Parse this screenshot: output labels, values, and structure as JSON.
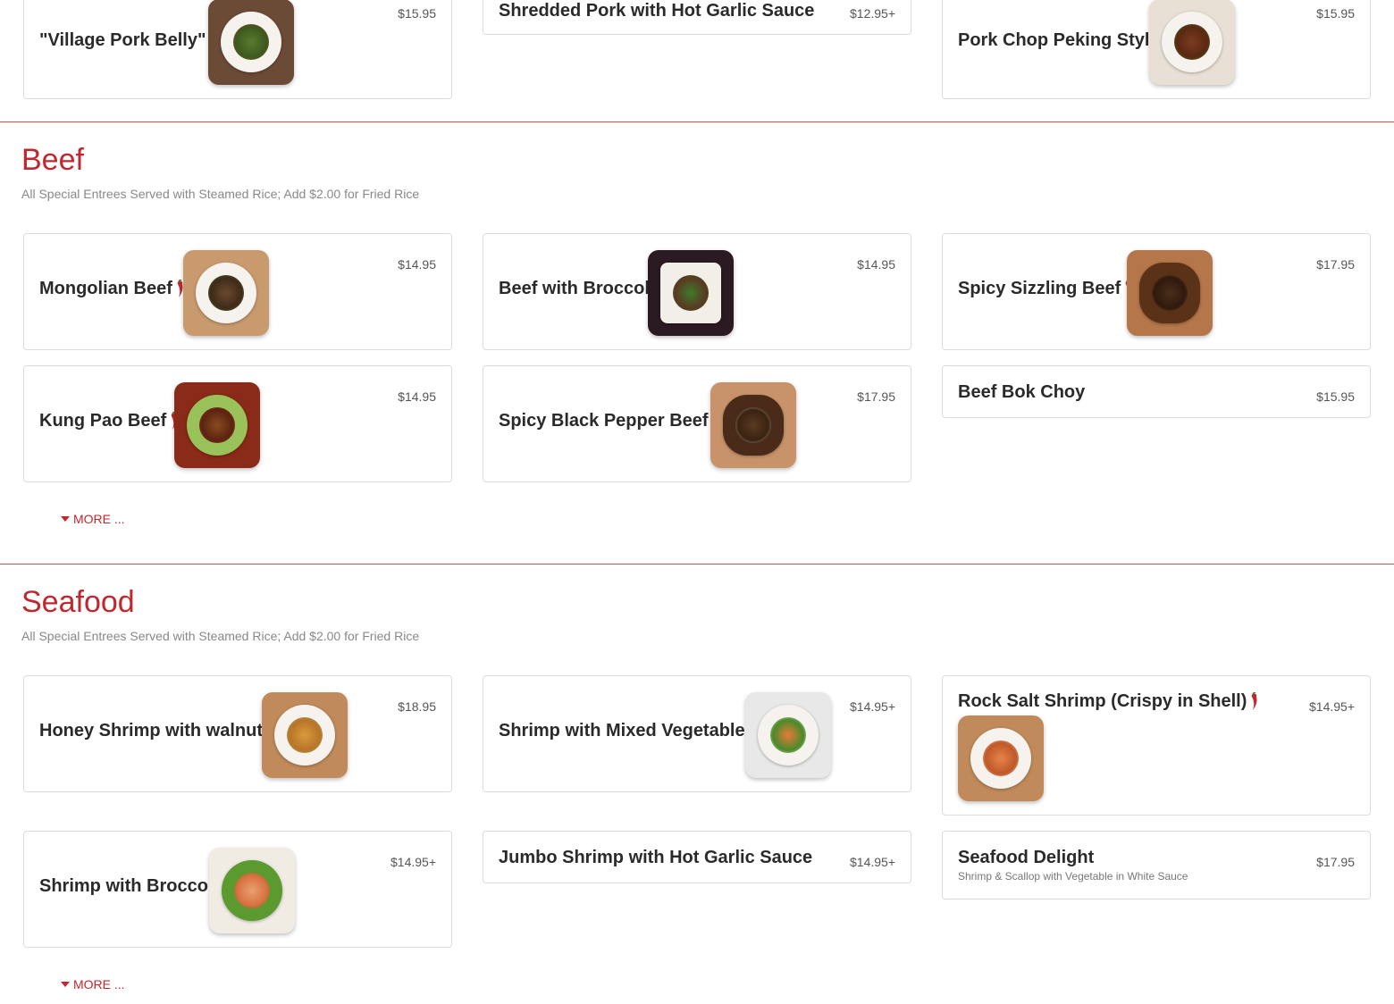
{
  "pork_tail": {
    "items": [
      {
        "name": "\"Village Pork Belly\"",
        "price": "$15.95",
        "spicy": true
      },
      {
        "name": "Shredded Pork with Hot Garlic Sauce",
        "price": "$12.95+",
        "spicy": false
      },
      {
        "name": "Pork Chop Peking Style",
        "price": "$15.95",
        "spicy": false
      }
    ]
  },
  "beef": {
    "title": "Beef",
    "subtitle": "All Special Entrees Served with Steamed Rice; Add $2.00 for Fried Rice",
    "items": [
      {
        "name": "Mongolian Beef",
        "price": "$14.95",
        "spicy": true
      },
      {
        "name": "Beef with Broccoli",
        "price": "$14.95",
        "spicy": false
      },
      {
        "name": "Spicy Sizzling Beef",
        "price": "$17.95",
        "spicy": true
      },
      {
        "name": "Kung Pao Beef",
        "price": "$14.95",
        "spicy": true
      },
      {
        "name": "Spicy Black Pepper Beef",
        "price": "$17.95",
        "spicy": true
      },
      {
        "name": "Beef Bok Choy",
        "price": "$15.95",
        "spicy": false
      }
    ],
    "more_label": "MORE ..."
  },
  "seafood": {
    "title": "Seafood",
    "subtitle": "All Special Entrees Served with Steamed Rice; Add $2.00 for Fried Rice",
    "items": [
      {
        "name": "Honey Shrimp with walnuts",
        "price": "$18.95",
        "spicy": false
      },
      {
        "name": "Shrimp with Mixed Vegetables",
        "price": "$14.95+",
        "spicy": false
      },
      {
        "name": "Rock Salt Shrimp (Crispy in Shell)",
        "price": "$14.95+",
        "spicy": true
      },
      {
        "name": "Shrimp with Broccoli",
        "price": "$14.95+",
        "spicy": false
      },
      {
        "name": "Jumbo Shrimp with Hot Garlic Sauce",
        "price": "$14.95+",
        "spicy": false
      },
      {
        "name": "Seafood Delight",
        "price": "$17.95",
        "spicy": false,
        "description": "Shrimp & Scallop with Vegetable in White Sauce"
      }
    ],
    "more_label": "MORE ..."
  },
  "colors": {
    "accent": "#c0282d",
    "pepper": "#c0282d",
    "card_border": "#dcdcdc"
  },
  "icons": {
    "spicy": "chili-pepper-icon",
    "more": "caret-down-icon"
  }
}
